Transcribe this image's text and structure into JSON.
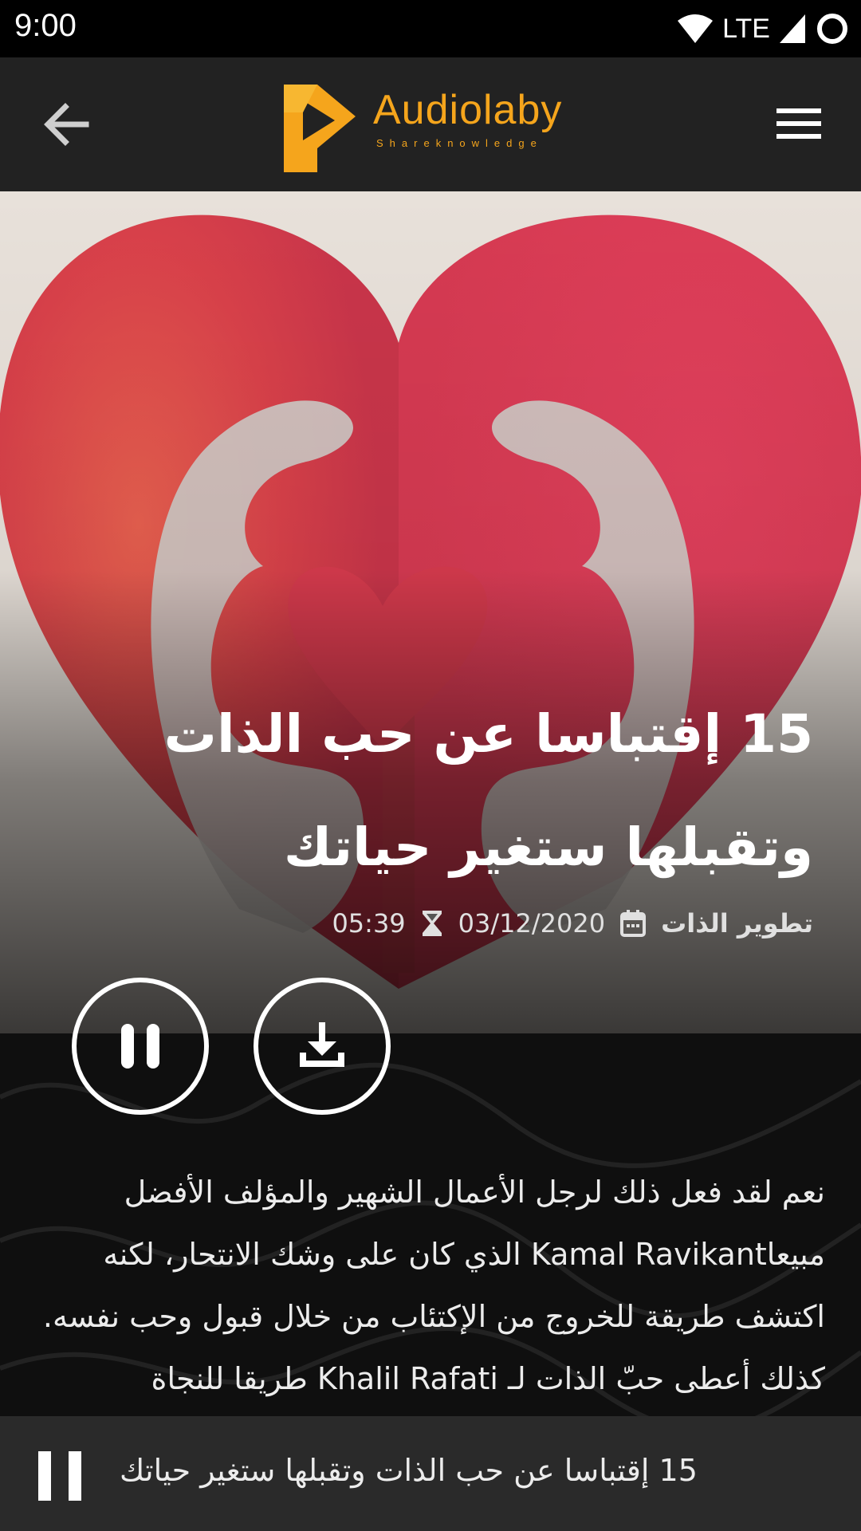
{
  "status_bar": {
    "time": "9:00",
    "network_label": "LTE",
    "icons": [
      "wifi-icon",
      "cell-signal-icon",
      "circle-icon"
    ]
  },
  "app_bar": {
    "logo_text": "Audiolaby",
    "logo_tagline": "Shareknowledge",
    "back_icon": "arrow-left-icon",
    "menu_icon": "hamburger-menu-icon",
    "brand_color": "#F5A51C"
  },
  "article": {
    "title": "15 إقتباسا عن حب الذات وتقبلها ستغير حياتك",
    "category": "تطوير الذات",
    "date": "03/12/2020",
    "duration": "05:39",
    "date_icon": "calendar-icon",
    "duration_icon": "hourglass-icon",
    "play_state_icon": "pause-icon",
    "download_icon": "download-icon",
    "description": "نعم لقد فعل ذلك لرجل الأعمال الشهير والمؤلف الأفضل مبيعاKamal Ravikant الذي كان على وشك الانتحار، لكنه اكتشف طريقة للخروج من الإكتئاب من خلال قبول وحب نفسه. كذلك أعطى حبّ الذات لـ Khalil Rafati طريقا للنجاة"
  },
  "mini_player": {
    "title": "15 إقتباسا عن حب الذات وتقبلها ستغير حياتك",
    "icon": "pause-icon"
  }
}
